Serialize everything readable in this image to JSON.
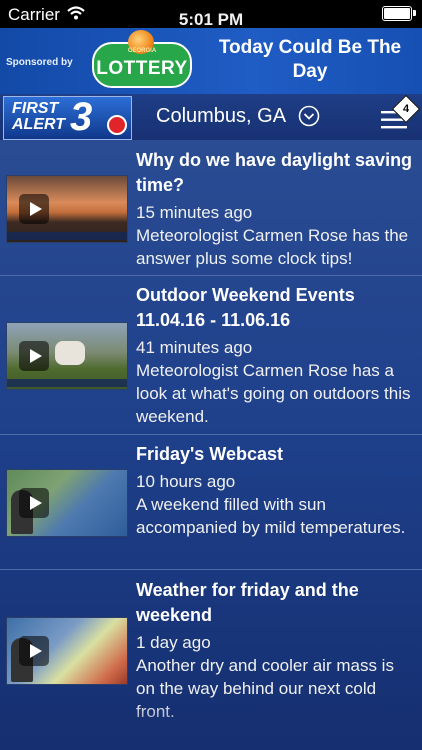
{
  "status_bar": {
    "carrier": "Carrier",
    "time": "5:01 PM"
  },
  "banner": {
    "sponsored_label": "Sponsored by",
    "lottery_small": "GEORGIA",
    "lottery_name": "LOTTERY",
    "slogan": "Today Could Be The Day"
  },
  "navbar": {
    "logo_line1": "FIRST",
    "logo_line2": "ALERT",
    "logo_number": "3",
    "city": "Columbus, GA",
    "menu_badge": "4"
  },
  "feed": {
    "items": [
      {
        "title": "Why do we have daylight saving time?",
        "time": "15 minutes ago",
        "description": "Meteorologist Carmen Rose has the answer plus some clock tips!"
      },
      {
        "title": "Outdoor Weekend Events 11.04.16 - 11.06.16",
        "time": "41 minutes ago",
        "description": "Meteorologist Carmen Rose has a look at what's going on outdoors this weekend."
      },
      {
        "title": "Friday's Webcast",
        "time": "10 hours ago",
        "description": "A weekend filled with sun accompanied by mild temperatures."
      },
      {
        "title": "Weather for friday and the weekend",
        "time": "1 day ago",
        "description": "Another dry and cooler air mass is on the way behind our next cold front."
      }
    ]
  },
  "colors": {
    "navbar_bg": "#1f3e86",
    "banner_bg": "#1f5cc4",
    "feed_bg": "#1e3f8a",
    "logo_accent": "#e0242a"
  },
  "icons": [
    "wifi-icon",
    "battery-icon",
    "chevron-down-circle-icon",
    "menu-icon",
    "play-icon"
  ]
}
